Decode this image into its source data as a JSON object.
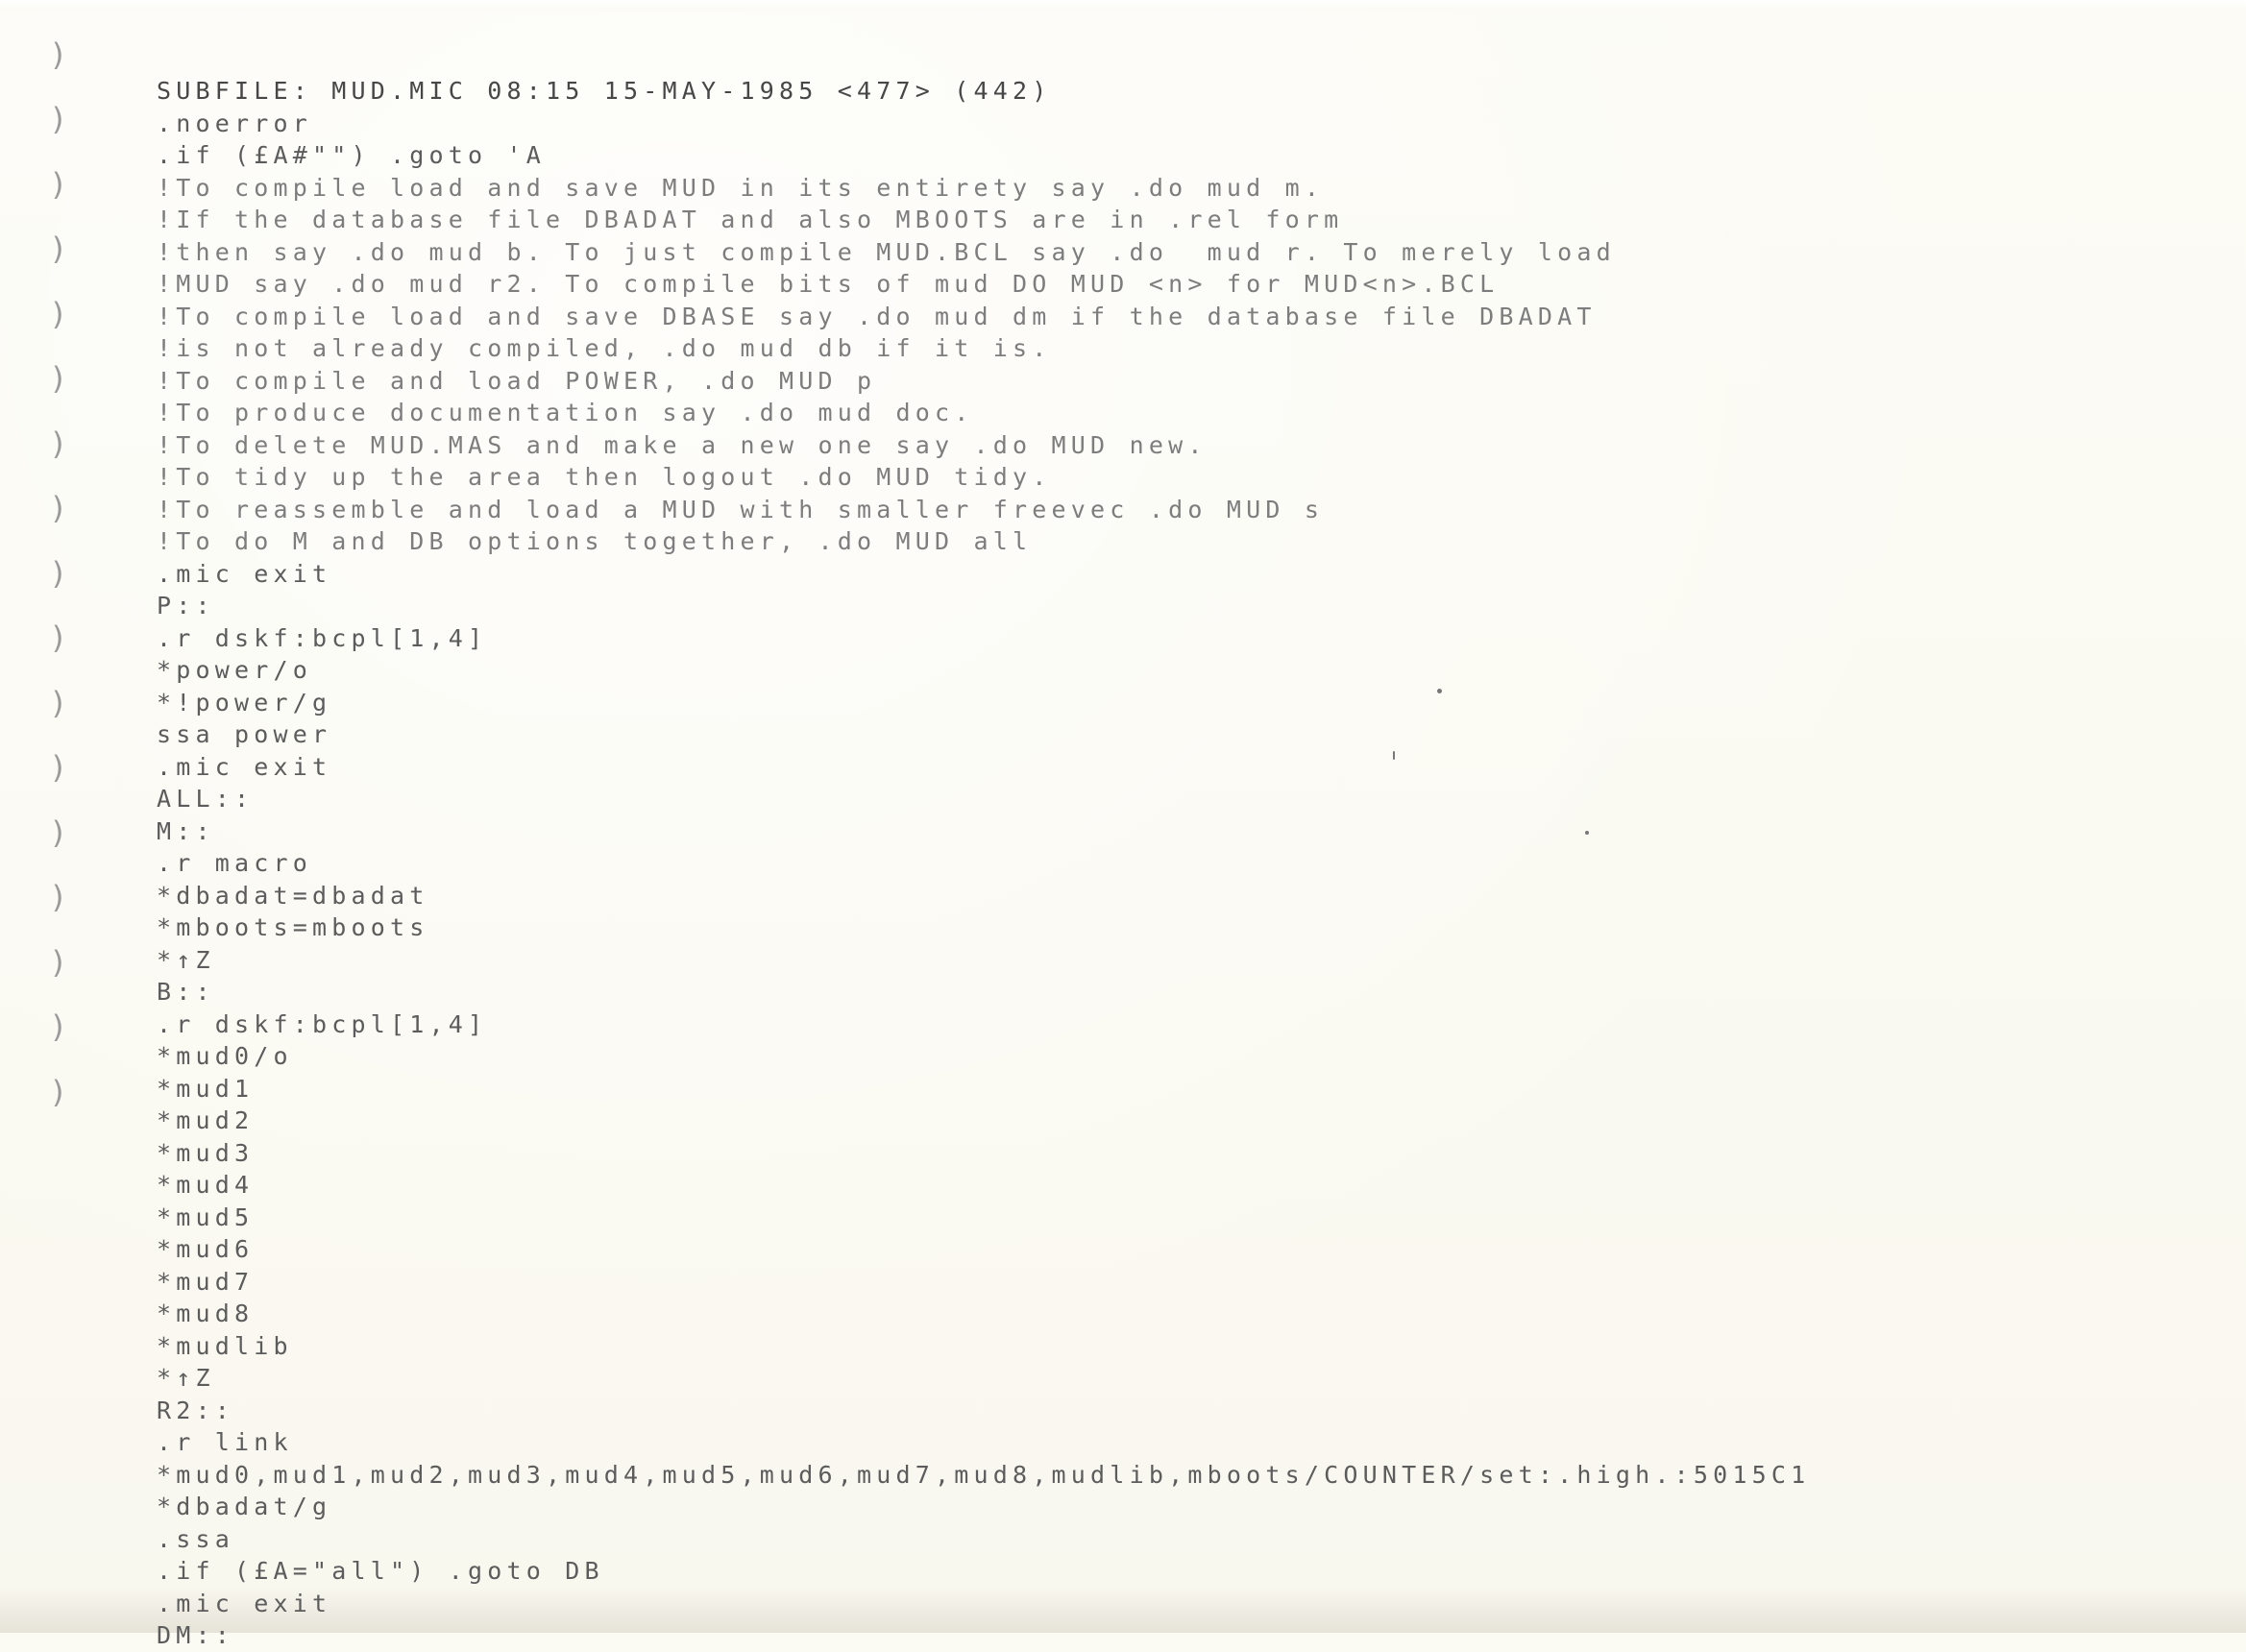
{
  "document": {
    "lines": [
      "SUBFILE: MUD.MIC 08:15 15-MAY-1985 <477> (442)",
      ".noerror",
      ".if (£A#\"\") .goto 'A",
      "!To compile load and save MUD in its entirety say .do mud m.",
      "!If the database file DBADAT and also MBOOTS are in .rel form",
      "!then say .do mud b. To just compile MUD.BCL say .do  mud r. To merely load",
      "!MUD say .do mud r2. To compile bits of mud DO MUD <n> for MUD<n>.BCL",
      "!To compile load and save DBASE say .do mud dm if the database file DBADAT",
      "!is not already compiled, .do mud db if it is.",
      "!To compile and load POWER, .do MUD p",
      "!To produce documentation say .do mud doc.",
      "!To delete MUD.MAS and make a new one say .do MUD new.",
      "!To tidy up the area then logout .do MUD tidy.",
      "!To reassemble and load a MUD with smaller freevec .do MUD s",
      "!To do M and DB options together, .do MUD all",
      ".mic exit",
      "P::",
      ".r dskf:bcpl[1,4]",
      "*power/o",
      "*!power/g",
      "ssa power",
      ".mic exit",
      "ALL::",
      "M::",
      ".r macro",
      "*dbadat=dbadat",
      "*mboots=mboots",
      "*↑Z",
      "B::",
      ".r dskf:bcpl[1,4]",
      "*mud0/o",
      "*mud1",
      "*mud2",
      "*mud3",
      "*mud4",
      "*mud5",
      "*mud6",
      "*mud7",
      "*mud8",
      "*mudlib",
      "*↑Z",
      "R2::",
      ".r link",
      "*mud0,mud1,mud2,mud3,mud4,mud5,mud6,mud7,mud8,mudlib,mboots/COUNTER/set:.high.:5015C1",
      "*dbadat/g",
      ".ssa",
      ".if (£A=\"all\") .goto DB",
      ".mic exit",
      "DM::"
    ]
  }
}
